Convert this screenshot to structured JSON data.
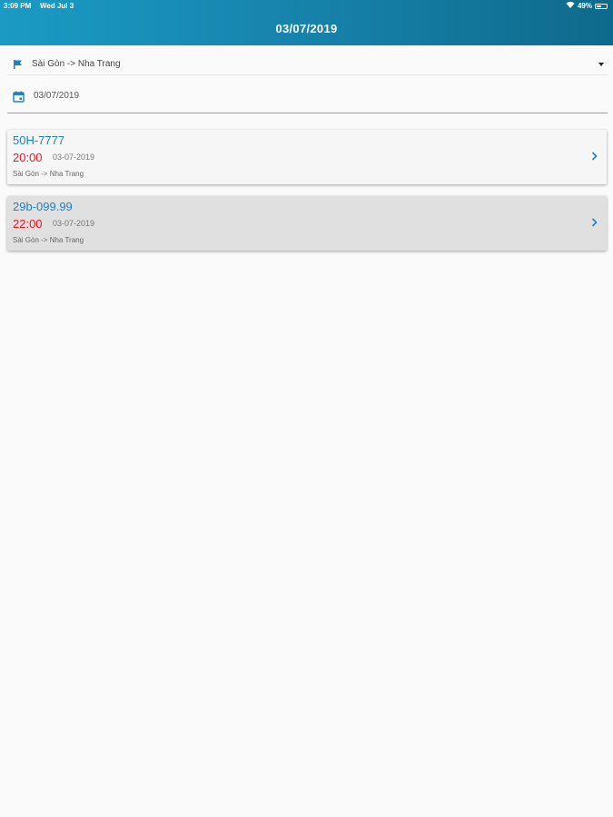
{
  "status_bar": {
    "time": "3:09 PM",
    "date": "Wed Jul 3",
    "battery": "49%",
    "battery_level": 0.49
  },
  "header": {
    "title": "03/07/2019"
  },
  "route_selector": {
    "value": "Sài Gòn -> Nha Trang",
    "icon": "flag-icon"
  },
  "date_selector": {
    "value": "03/07/2019",
    "icon": "calendar-icon"
  },
  "trips": [
    {
      "plate": "50H-7777",
      "time": "20:00",
      "date": "03-07-2019",
      "route": "Sài Gòn -> Nha Trang"
    },
    {
      "plate": "29b-099.99",
      "time": "22:00",
      "date": "03-07-2019",
      "route": "Sài Gòn -> Nha Trang"
    }
  ],
  "colors": {
    "header_start": "#1a9bc4",
    "header_end": "#0e6a8c",
    "plate": "#1f82bd",
    "time": "#f0141e",
    "icon": "#1f82bd"
  }
}
